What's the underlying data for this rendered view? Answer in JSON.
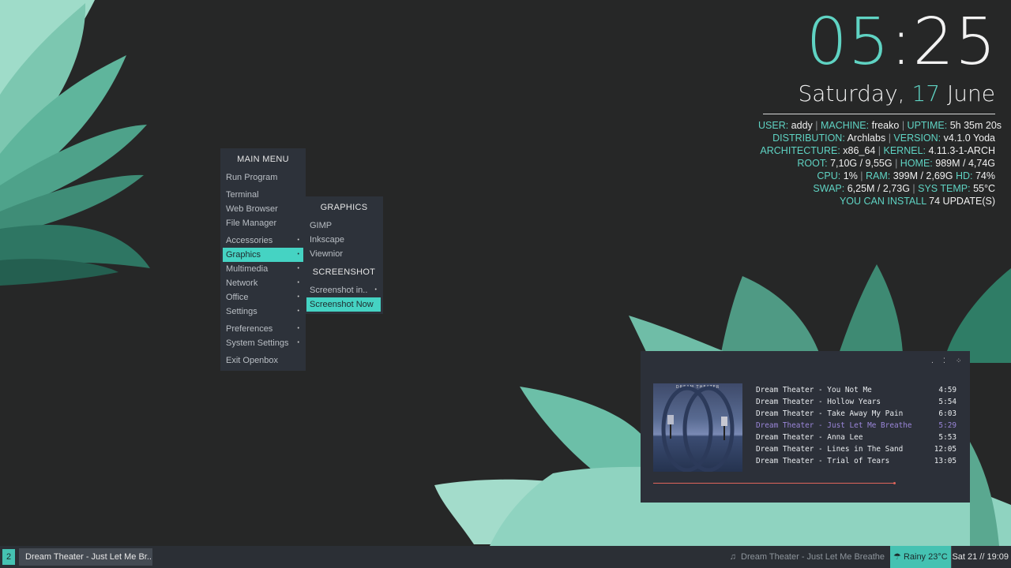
{
  "conky": {
    "clock": {
      "hours": "05",
      "colon": ":",
      "minutes": "25"
    },
    "date": {
      "weekday": "Saturday,",
      "day": "17",
      "month": "June"
    },
    "lines": [
      [
        {
          "k": "USER:",
          "v": " addy"
        },
        {
          "s": " | "
        },
        {
          "k": "MACHINE:",
          "v": " freako"
        },
        {
          "s": " | "
        },
        {
          "k": "UPTIME:",
          "v": " 5h 35m 20s"
        }
      ],
      [
        {
          "k": "DISTRIBUTION:",
          "v": " Archlabs"
        },
        {
          "s": " | "
        },
        {
          "k": "VERSION:",
          "v": " v4.1.0 Yoda"
        }
      ],
      [
        {
          "k": "ARCHITECTURE:",
          "v": " x86_64"
        },
        {
          "s": " | "
        },
        {
          "k": "KERNEL:",
          "v": " 4.11.3-1-ARCH"
        }
      ],
      [
        {
          "k": "ROOT:",
          "v": " 7,10G / 9,55G"
        },
        {
          "s": " | "
        },
        {
          "k": "HOME:",
          "v": " 989M / 4,74G"
        }
      ],
      [
        {
          "k": "CPU:",
          "v": " 1%"
        },
        {
          "s": " | "
        },
        {
          "k": "RAM:",
          "v": " 399M / 2,69G"
        },
        {
          "s": " "
        },
        {
          "k": "HD:",
          "v": " 74%"
        }
      ],
      [
        {
          "k": "SWAP:",
          "v": " 6,25M / 2,73G"
        },
        {
          "s": " | "
        },
        {
          "k": "SYS TEMP:",
          "v": " 55°C"
        }
      ],
      [
        {
          "k": "YOU CAN INSTALL",
          "v": " 74 UPDATE(S)"
        }
      ]
    ]
  },
  "main_menu": {
    "title": "MAIN MENU",
    "run_program": "Run Program",
    "terminal": "Terminal",
    "web_browser": "Web Browser",
    "file_manager": "File Manager",
    "accessories": "Accessories",
    "graphics": "Graphics",
    "multimedia": "Multimedia",
    "network": "Network",
    "office": "Office",
    "settings": "Settings",
    "preferences": "Preferences",
    "system_settings": "System Settings",
    "exit": "Exit Openbox",
    "arrow": "•"
  },
  "graphics_menu": {
    "title": "GRAPHICS",
    "gimp": "GIMP",
    "inkscape": "Inkscape",
    "viewnior": "Viewnior",
    "screenshot_header": "SCREENSHOT",
    "screenshot_in": "Screenshot in..",
    "screenshot_now": "Screenshot Now",
    "arrow": "•"
  },
  "player": {
    "controls": [
      ".",
      "⁚",
      "⁘"
    ],
    "cover_text": "DREAM THEATER",
    "tracks": [
      {
        "title": "Dream Theater - You Not Me",
        "duration": "4:59"
      },
      {
        "title": "Dream Theater - Hollow Years",
        "duration": "5:54"
      },
      {
        "title": "Dream Theater - Take Away My Pain",
        "duration": "6:03"
      },
      {
        "title": "Dream Theater - Just Let Me Breathe",
        "duration": "5:29"
      },
      {
        "title": "Dream Theater - Anna Lee",
        "duration": "5:53"
      },
      {
        "title": "Dream Theater - Lines in The Sand",
        "duration": "12:05"
      },
      {
        "title": "Dream Theater - Trial of Tears",
        "duration": "13:05"
      }
    ],
    "now_playing_index": 3,
    "progress_fraction": 0.99
  },
  "taskbar": {
    "workspace": "2",
    "task": "Dream Theater - Just Let Me Br...",
    "now_playing_icon": "♫",
    "now_playing": "Dream Theater - Just Let Me Breathe",
    "weather_icon": "☂",
    "weather": "Rainy 23°C",
    "datetime": "Sat 21 // 19:09"
  },
  "colors": {
    "accent": "#45d3c3",
    "now_playing": "#9a86d9",
    "progress": "#e0655b"
  }
}
